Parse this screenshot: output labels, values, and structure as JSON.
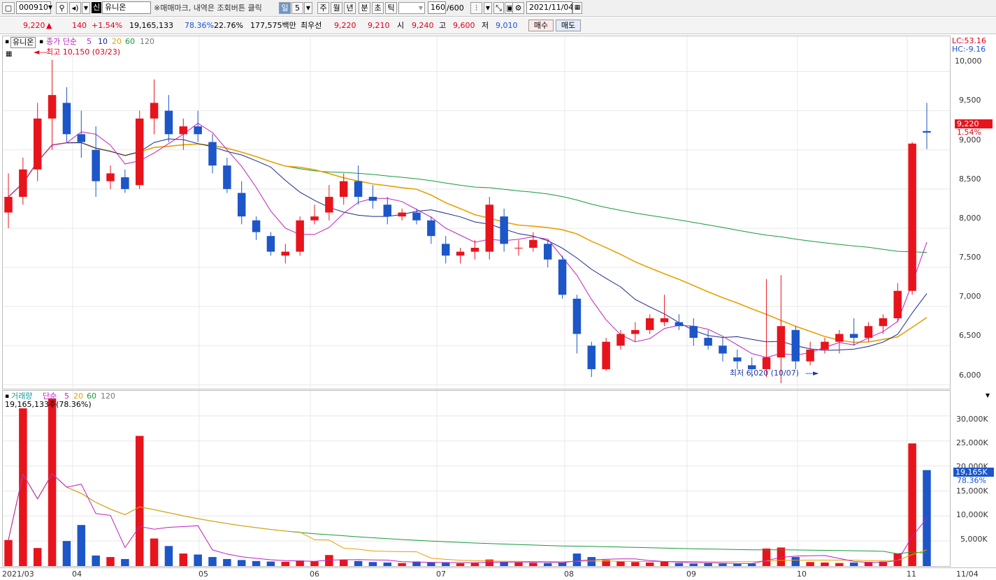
{
  "toolbar": {
    "code": "000910",
    "badge": "신",
    "name": "유니온",
    "notice": "※매매마크, 내역은 조회버튼 클릭",
    "period_tabs": [
      "일",
      "5",
      "주",
      "월",
      "년",
      "분",
      "초",
      "틱"
    ],
    "count": "160",
    "count_total": "/600",
    "date": "2021/11/04"
  },
  "quote": {
    "price": "9,220",
    "arrow": "▲",
    "change": "140",
    "change_pct": "+1.54%",
    "volume": "19,165,133",
    "vol_ratio": "78.36%",
    "turnover": "22.76%",
    "amount": "177,575백만",
    "priority_label": "최우선",
    "ask": "9,220",
    "bid": "9,210",
    "open_label": "시",
    "open": "9,240",
    "high_label": "고",
    "high": "9,600",
    "low_label": "저",
    "low": "9,010",
    "buy_label": "매수",
    "sell_label": "매도"
  },
  "price_panel": {
    "stock_label": "유니온",
    "legend_label": "종가 단순",
    "ma_periods": [
      "5",
      "10",
      "20",
      "60",
      "120"
    ],
    "high_annotation": "최고 10,150 (03/23)",
    "low_annotation": "최저 6,020 (10/07)",
    "lc_label": "LC:53.16",
    "hc_label": "HC:-9.16",
    "price_tag": "9,220",
    "price_tag_pct": "1.54%"
  },
  "volume_panel": {
    "legend_label": "거래량",
    "legend_ma_label": "단순",
    "ma_periods": [
      "5",
      "20",
      "60",
      "120"
    ],
    "current_line": "19,165,133주(78.36%)",
    "vol_tag": "19,165K",
    "vol_tag_pct": "78.36%"
  },
  "colors": {
    "up": "#e8141c",
    "down": "#1c56c8",
    "ma5": "#c020c0",
    "ma10": "#1a2a8c",
    "ma20": "#e8a000",
    "ma60": "#169a3a",
    "ma120": "#7a7a7a"
  },
  "chart_data": {
    "type": "candlestick",
    "x_labels": [
      "2021/03",
      "04",
      "05",
      "06",
      "07",
      "08",
      "09",
      "10",
      "11",
      "11/04"
    ],
    "price_axis": [
      "10,000",
      "9,500",
      "9,000",
      "8,500",
      "8,000",
      "7,500",
      "7,000",
      "6,500",
      "6,000"
    ],
    "volume_axis": [
      "30,000K",
      "25,000K",
      "20,000K",
      "15,000K",
      "10,000K",
      "5,000K"
    ],
    "ylim_price": [
      5950,
      10450
    ],
    "ylim_volume": [
      0,
      35000
    ],
    "price_series": [
      {
        "open": 8200,
        "high": 8700,
        "low": 8000,
        "close": 8400
      },
      {
        "open": 8400,
        "high": 8900,
        "low": 8300,
        "close": 8750
      },
      {
        "open": 8750,
        "high": 9600,
        "low": 8600,
        "close": 9400
      },
      {
        "open": 9400,
        "high": 10150,
        "low": 9000,
        "close": 9700
      },
      {
        "open": 9600,
        "high": 9800,
        "low": 9100,
        "close": 9200
      },
      {
        "open": 9200,
        "high": 9500,
        "low": 8900,
        "close": 9100
      },
      {
        "open": 9000,
        "high": 9300,
        "low": 8400,
        "close": 8600
      },
      {
        "open": 8600,
        "high": 8800,
        "low": 8500,
        "close": 8700
      },
      {
        "open": 8650,
        "high": 8750,
        "low": 8450,
        "close": 8500
      },
      {
        "open": 8550,
        "high": 9500,
        "low": 8500,
        "close": 9400
      },
      {
        "open": 9400,
        "high": 9900,
        "low": 9200,
        "close": 9600
      },
      {
        "open": 9500,
        "high": 9700,
        "low": 9100,
        "close": 9200
      },
      {
        "open": 9200,
        "high": 9400,
        "low": 9000,
        "close": 9300
      },
      {
        "open": 9300,
        "high": 9500,
        "low": 9100,
        "close": 9200
      },
      {
        "open": 9100,
        "high": 9200,
        "low": 8700,
        "close": 8800
      },
      {
        "open": 8800,
        "high": 8900,
        "low": 8450,
        "close": 8500
      },
      {
        "open": 8450,
        "high": 8600,
        "low": 8050,
        "close": 8150
      },
      {
        "open": 8100,
        "high": 8150,
        "low": 7850,
        "close": 7950
      },
      {
        "open": 7900,
        "high": 7950,
        "low": 7650,
        "close": 7700
      },
      {
        "open": 7650,
        "high": 7800,
        "low": 7550,
        "close": 7700
      },
      {
        "open": 7700,
        "high": 8150,
        "low": 7650,
        "close": 8100
      },
      {
        "open": 8100,
        "high": 8300,
        "low": 8050,
        "close": 8150
      },
      {
        "open": 8200,
        "high": 8550,
        "low": 8100,
        "close": 8400
      },
      {
        "open": 8400,
        "high": 8700,
        "low": 8300,
        "close": 8600
      },
      {
        "open": 8600,
        "high": 8800,
        "low": 8300,
        "close": 8400
      },
      {
        "open": 8400,
        "high": 8550,
        "low": 8250,
        "close": 8350
      },
      {
        "open": 8300,
        "high": 8400,
        "low": 8050,
        "close": 8150
      },
      {
        "open": 8150,
        "high": 8250,
        "low": 8100,
        "close": 8200
      },
      {
        "open": 8200,
        "high": 8250,
        "low": 8050,
        "close": 8100
      },
      {
        "open": 8100,
        "high": 8150,
        "low": 7800,
        "close": 7900
      },
      {
        "open": 7800,
        "high": 7900,
        "low": 7550,
        "close": 7650
      },
      {
        "open": 7650,
        "high": 7750,
        "low": 7550,
        "close": 7700
      },
      {
        "open": 7700,
        "high": 7850,
        "low": 7600,
        "close": 7750
      },
      {
        "open": 7700,
        "high": 8400,
        "low": 7600,
        "close": 8300
      },
      {
        "open": 8150,
        "high": 8250,
        "low": 7700,
        "close": 7800
      },
      {
        "open": 7750,
        "high": 7850,
        "low": 7650,
        "close": 7750
      },
      {
        "open": 7750,
        "high": 7950,
        "low": 7700,
        "close": 7850
      },
      {
        "open": 7800,
        "high": 7850,
        "low": 7500,
        "close": 7600
      },
      {
        "open": 7600,
        "high": 7650,
        "low": 7100,
        "close": 7150
      },
      {
        "open": 7100,
        "high": 7150,
        "low": 6400,
        "close": 6650
      },
      {
        "open": 6500,
        "high": 6550,
        "low": 6100,
        "close": 6200
      },
      {
        "open": 6200,
        "high": 6600,
        "low": 6180,
        "close": 6550
      },
      {
        "open": 6500,
        "high": 6700,
        "low": 6450,
        "close": 6650
      },
      {
        "open": 6650,
        "high": 6800,
        "low": 6550,
        "close": 6700
      },
      {
        "open": 6700,
        "high": 6900,
        "low": 6650,
        "close": 6850
      },
      {
        "open": 6800,
        "high": 7150,
        "low": 6750,
        "close": 6850
      },
      {
        "open": 6800,
        "high": 6900,
        "low": 6700,
        "close": 6750
      },
      {
        "open": 6750,
        "high": 6850,
        "low": 6500,
        "close": 6600
      },
      {
        "open": 6600,
        "high": 6700,
        "low": 6450,
        "close": 6500
      },
      {
        "open": 6500,
        "high": 6600,
        "low": 6300,
        "close": 6400
      },
      {
        "open": 6350,
        "high": 6450,
        "low": 6200,
        "close": 6300
      },
      {
        "open": 6250,
        "high": 6350,
        "low": 6100,
        "close": 6200
      },
      {
        "open": 6200,
        "high": 7350,
        "low": 6100,
        "close": 6350
      },
      {
        "open": 6350,
        "high": 7400,
        "low": 6020,
        "close": 6750
      },
      {
        "open": 6700,
        "high": 6750,
        "low": 6200,
        "close": 6300
      },
      {
        "open": 6300,
        "high": 6550,
        "low": 6250,
        "close": 6450
      },
      {
        "open": 6450,
        "high": 6600,
        "low": 6400,
        "close": 6550
      },
      {
        "open": 6550,
        "high": 6700,
        "low": 6400,
        "close": 6650
      },
      {
        "open": 6650,
        "high": 6850,
        "low": 6500,
        "close": 6600
      },
      {
        "open": 6600,
        "high": 6800,
        "low": 6550,
        "close": 6750
      },
      {
        "open": 6750,
        "high": 6900,
        "low": 6650,
        "close": 6850
      },
      {
        "open": 6850,
        "high": 7300,
        "low": 6800,
        "close": 7200
      },
      {
        "open": 7200,
        "high": 9100,
        "low": 7150,
        "close": 9080
      },
      {
        "open": 9240,
        "high": 9600,
        "low": 9010,
        "close": 9220
      }
    ],
    "volume_series": [
      5200,
      31500,
      3600,
      33500,
      5000,
      8200,
      2100,
      1800,
      1400,
      26000,
      5500,
      4000,
      2500,
      2300,
      1800,
      1400,
      1200,
      1000,
      900,
      850,
      1100,
      900,
      2200,
      1200,
      1000,
      800,
      700,
      600,
      900,
      700,
      650,
      550,
      600,
      1300,
      800,
      700,
      650,
      600,
      700,
      2500,
      1800,
      1200,
      900,
      800,
      700,
      900,
      600,
      500,
      550,
      500,
      450,
      500,
      3500,
      3700,
      1800,
      800,
      700,
      600,
      700,
      800,
      900,
      2500,
      24500,
      19165
    ]
  }
}
